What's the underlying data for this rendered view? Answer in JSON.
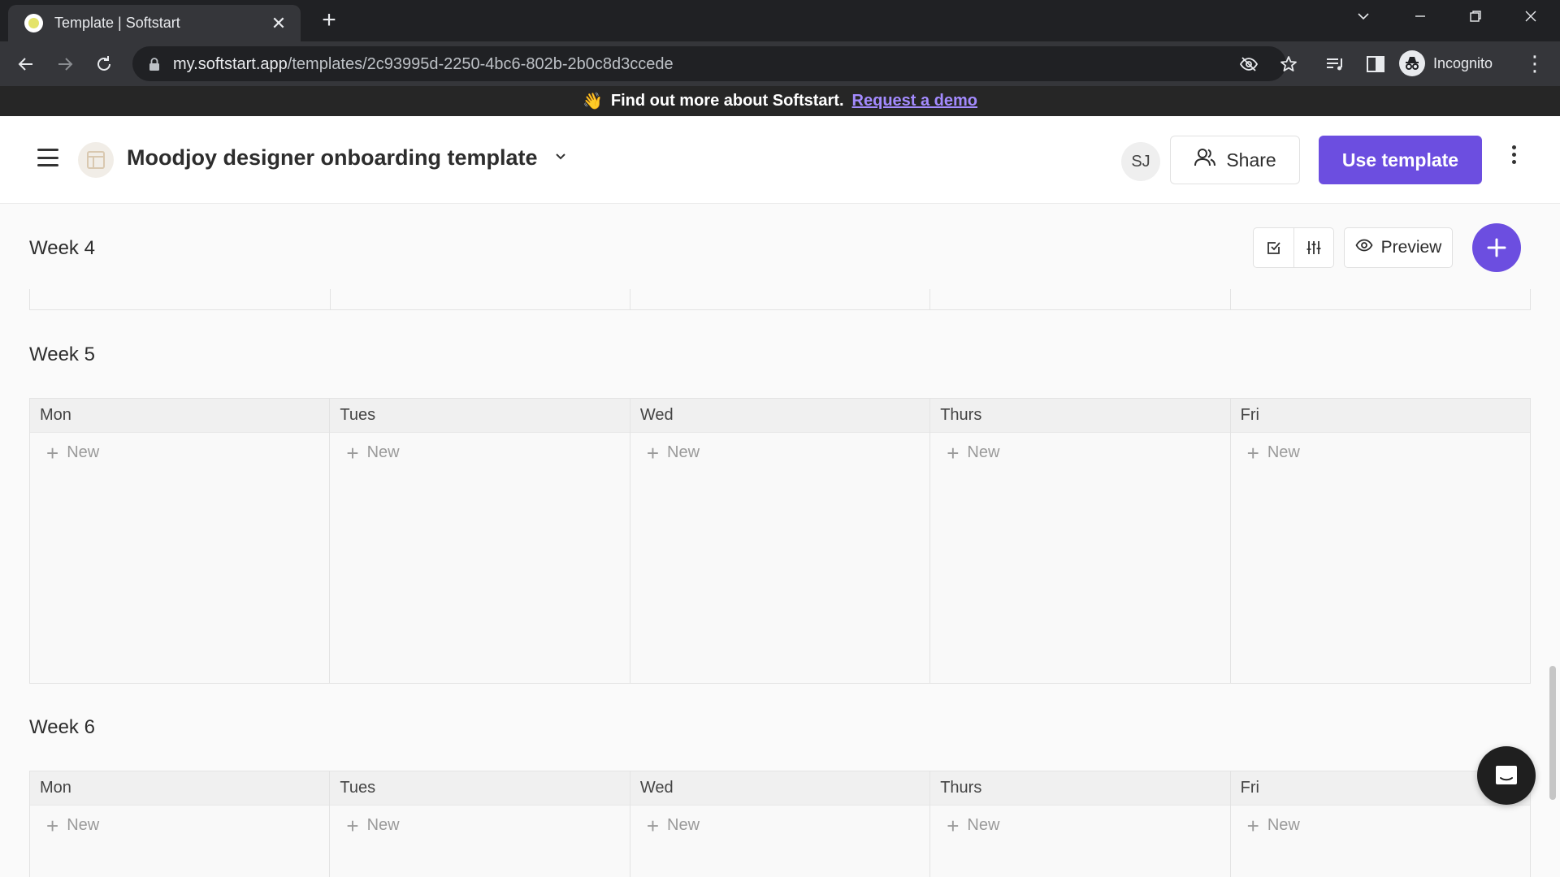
{
  "browser": {
    "tab_title": "Template | Softstart",
    "url_host": "my.softstart.app",
    "url_path": "/templates/2c93995d-2250-4bc6-802b-2b0c8d3ccede",
    "profile_label": "Incognito"
  },
  "banner": {
    "emoji": "👋",
    "text": "Find out more about Softstart.",
    "link": "Request a demo"
  },
  "header": {
    "title": "Moodjoy designer onboarding template",
    "avatar_initials": "SJ",
    "share_label": "Share",
    "use_template_label": "Use template"
  },
  "toolbar": {
    "preview_label": "Preview"
  },
  "weeks": [
    {
      "title": "Week 4",
      "days": []
    },
    {
      "title": "Week 5",
      "days": [
        {
          "name": "Mon",
          "new_label": "New"
        },
        {
          "name": "Tues",
          "new_label": "New"
        },
        {
          "name": "Wed",
          "new_label": "New"
        },
        {
          "name": "Thurs",
          "new_label": "New"
        },
        {
          "name": "Fri",
          "new_label": "New"
        }
      ]
    },
    {
      "title": "Week 6",
      "days": [
        {
          "name": "Mon",
          "new_label": "New"
        },
        {
          "name": "Tues",
          "new_label": "New"
        },
        {
          "name": "Wed",
          "new_label": "New"
        },
        {
          "name": "Thurs",
          "new_label": "New"
        },
        {
          "name": "Fri",
          "new_label": "New"
        }
      ]
    }
  ],
  "colors": {
    "accent": "#6c4ee0",
    "banner_bg": "#262626",
    "banner_link": "#a48bff"
  }
}
